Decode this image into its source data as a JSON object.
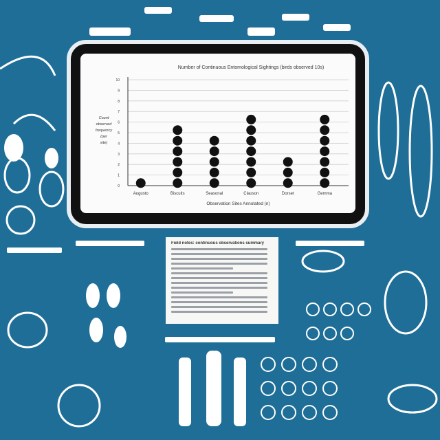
{
  "colors": {
    "background": "#1f6e97",
    "dot": "#111111",
    "ink": "#ffffff"
  },
  "chart_data": {
    "type": "dot",
    "title": "Number of Continuous Entomological Sightings (birds observed 10s)",
    "xlabel": "Observation Sites Annotated (n)",
    "ylabel": "Count observed frequency (per site)",
    "categories": [
      "Augusto",
      "Biscuits",
      "Seasonal",
      "Clauson",
      "Dorset",
      "Gemma"
    ],
    "values": [
      1,
      6,
      5,
      7,
      3,
      7
    ],
    "yticks": [
      0,
      1,
      2,
      3,
      4,
      5,
      6,
      7,
      8,
      9,
      10
    ],
    "ylim": [
      0,
      10
    ],
    "grid": true
  },
  "document": {
    "title": "Field notes: continuous observations summary",
    "line_count": 14
  }
}
